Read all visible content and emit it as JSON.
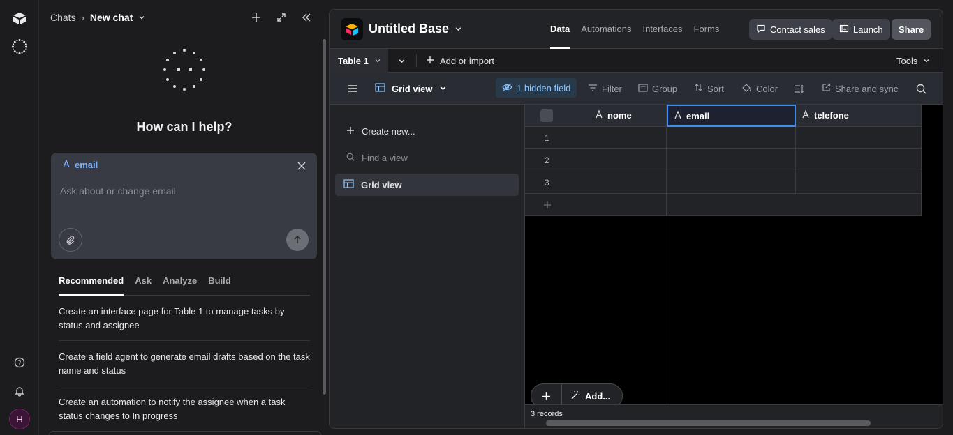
{
  "rail": {
    "avatar_initial": "H"
  },
  "chat": {
    "breadcrumb_root": "Chats",
    "breadcrumb_current": "New chat",
    "help_title": "How can I help?",
    "composer": {
      "field_label": "email",
      "placeholder": "Ask about or change email"
    },
    "tabs": [
      "Recommended",
      "Ask",
      "Analyze",
      "Build"
    ],
    "suggestions": [
      "Create an interface page for Table 1 to manage tasks by status and assignee",
      "Create a field agent to generate email drafts based on the task name and status",
      "Create an automation to notify the assignee when a task status changes to In progress"
    ]
  },
  "app": {
    "base_title": "Untitled Base",
    "nav": [
      "Data",
      "Automations",
      "Interfaces",
      "Forms"
    ],
    "contact_sales": "Contact sales",
    "launch": "Launch",
    "share": "Share",
    "table_tab": "Table 1",
    "add_or_import": "Add or import",
    "tools": "Tools",
    "view_name": "Grid view",
    "hidden_fields": "1 hidden field",
    "filter": "Filter",
    "group": "Group",
    "sort": "Sort",
    "color": "Color",
    "share_sync": "Share and sync",
    "sidebar": {
      "create_new": "Create new...",
      "find_view": "Find a view",
      "grid_view": "Grid view"
    },
    "columns": [
      "nome",
      "email",
      "telefone"
    ],
    "rows": [
      "1",
      "2",
      "3"
    ],
    "add_button": "Add...",
    "records": "3 records"
  }
}
